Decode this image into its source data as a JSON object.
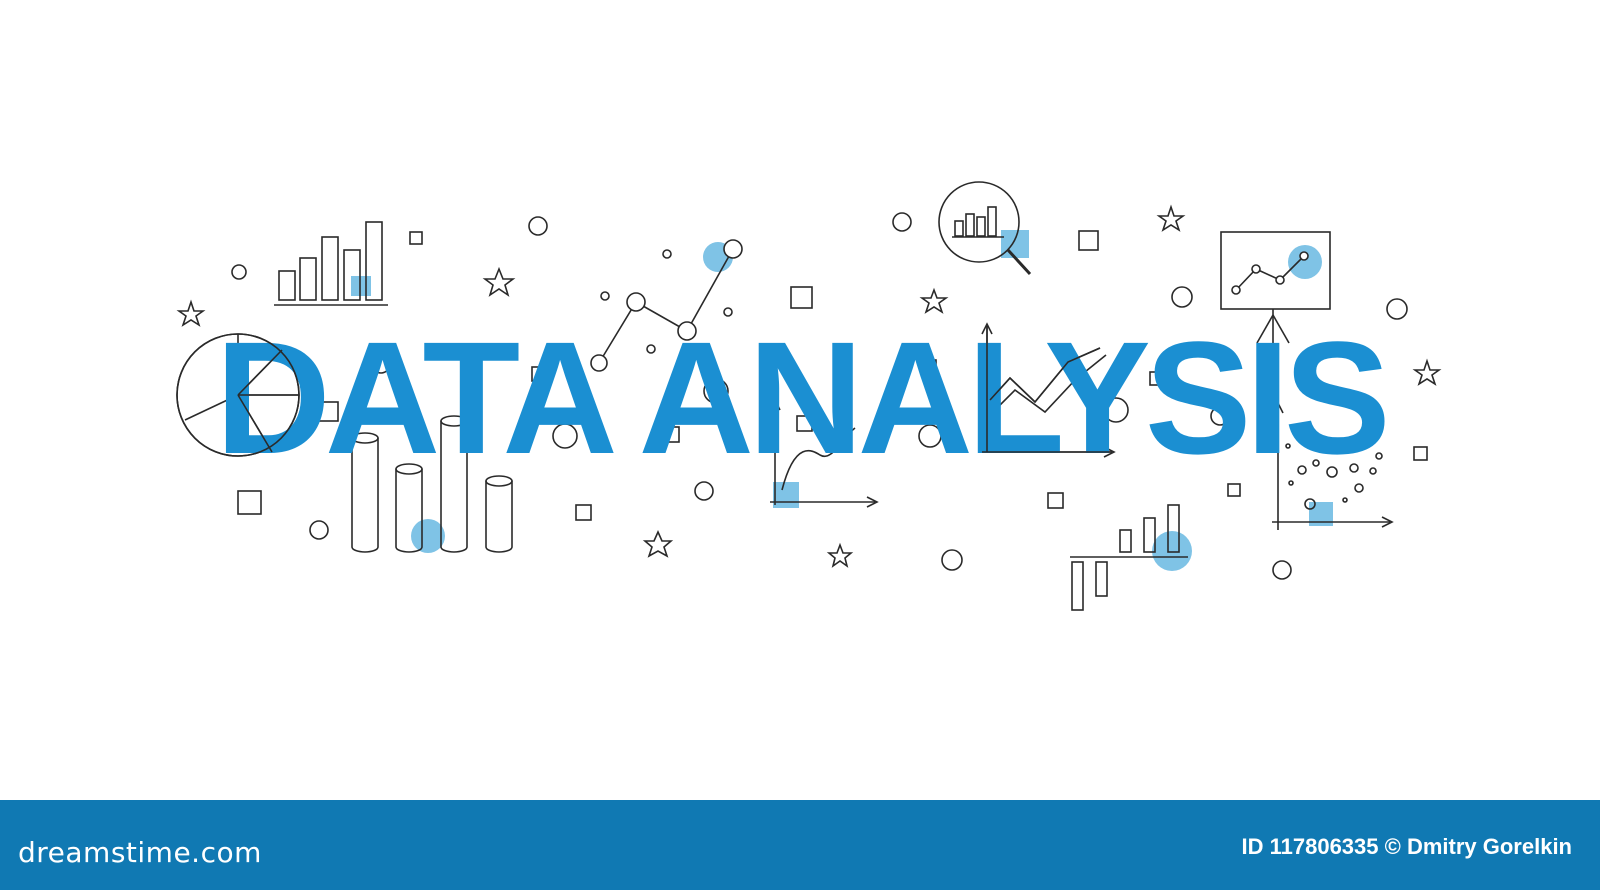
{
  "headline": "DATA ANALYSIS",
  "footer": {
    "logo_text": "dreamstime.com",
    "credit_text": "ID 117806335 © Dmitry Gorelkin"
  },
  "colors": {
    "headline": "#1b8fd2",
    "accent_light": "#7fc3e6",
    "line": "#2a2a2a",
    "footer_bar": "#1079b3",
    "footer_text": "#ffffff",
    "background": "#ffffff"
  },
  "icons": [
    "pie-chart-icon",
    "bar-chart-icon",
    "cylinder-bar-chart-icon",
    "line-graph-icon",
    "magnifier-chart-icon",
    "line-chart-icon",
    "presentation-board-icon",
    "scatter-plot-icon",
    "positive-negative-bar-chart-icon",
    "star-icon",
    "circle-icon",
    "square-icon",
    "dreamstime-logo-icon"
  ]
}
